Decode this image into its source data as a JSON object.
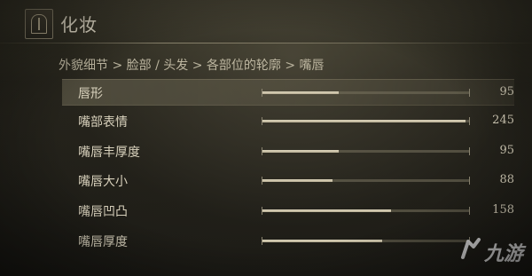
{
  "header": {
    "title": "化妆",
    "crest_icon": "sanctuary-crest-icon"
  },
  "breadcrumb": "外貌细节 > 脸部 / 头发 > 各部位的轮廓 > 嘴唇",
  "rows": [
    {
      "label": "唇形",
      "value": "95",
      "level": 0.37,
      "selected": true
    },
    {
      "label": "嘴部表情",
      "value": "245",
      "level": 0.98,
      "selected": false
    },
    {
      "label": "嘴唇丰厚度",
      "value": "95",
      "level": 0.37,
      "selected": false
    },
    {
      "label": "嘴唇大小",
      "value": "88",
      "level": 0.34,
      "selected": false
    },
    {
      "label": "嘴唇凹凸",
      "value": "158",
      "level": 0.62,
      "selected": false
    },
    {
      "label": "嘴唇厚度",
      "value": "",
      "level": 0.58,
      "selected": false
    }
  ],
  "watermark": {
    "text": "九游",
    "icon": "jiuyou-logo-icon"
  },
  "colors": {
    "slider_fill": "#ddd5bd",
    "selected_row": "#6e6955",
    "background": "#1a1914"
  }
}
